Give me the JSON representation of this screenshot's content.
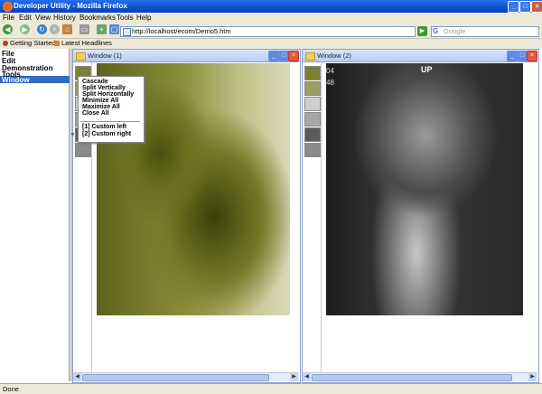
{
  "window": {
    "title": "Developer Utility - Mozilla Firefox",
    "controls": {
      "minimize": "_",
      "maximize": "□",
      "close": "×"
    }
  },
  "menubar": [
    "File",
    "Edit",
    "View",
    "History",
    "Bookmarks",
    "Tools",
    "Help"
  ],
  "toolbar": {
    "url": "http://localhost/ecom/Demo5.htm",
    "search_placeholder": "Google",
    "search_engine_glyph": "G",
    "go_glyph": "▶"
  },
  "bookmarks": [
    "Getting Started",
    "Latest Headlines"
  ],
  "sidebar": {
    "items": [
      "File",
      "Edit",
      "Demonstration",
      "Tools",
      "Window"
    ],
    "active": "Window"
  },
  "window_menu": {
    "items": [
      "Cascade",
      "Split Vertically",
      "Split Horizontally",
      "Minimize All",
      "Maximize All",
      "Close All"
    ],
    "custom_items": [
      "[1] Custom left",
      "[2] Custom right"
    ]
  },
  "inner_windows": [
    {
      "title": "Window (1)",
      "thumbnail_count": 6
    },
    {
      "title": "Window (2)",
      "thumbnail_count": 6
    }
  ],
  "xray2_overlay": {
    "label": "UP",
    "digits": "04",
    "digits2": "48"
  },
  "status": "Done",
  "colors": {
    "titlebar": "#0a4fd1",
    "selection": "#316ac5",
    "xray1_tint": "#757a28"
  }
}
